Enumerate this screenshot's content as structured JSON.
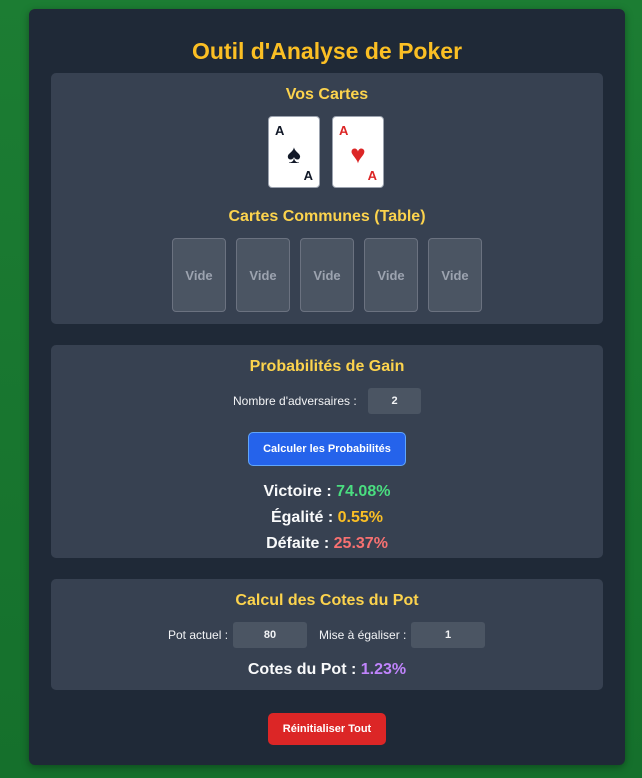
{
  "app": {
    "title": "Outil d'Analyse de Poker"
  },
  "hand": {
    "title": "Vos Cartes",
    "cards": [
      {
        "rank": "A",
        "suit": "♠",
        "color": "black"
      },
      {
        "rank": "A",
        "suit": "♥",
        "color": "red"
      }
    ]
  },
  "board": {
    "title": "Cartes Communes (Table)",
    "slots": [
      "Vide",
      "Vide",
      "Vide",
      "Vide",
      "Vide"
    ]
  },
  "probabilities": {
    "title": "Probabilités de Gain",
    "opponents_label": "Nombre d'adversaires :",
    "opponents_value": "2",
    "calculate_label": "Calculer les Probabilités",
    "win_label": "Victoire :",
    "win_value": "74.08%",
    "tie_label": "Égalité :",
    "tie_value": "0.55%",
    "loss_label": "Défaite :",
    "loss_value": "25.37%"
  },
  "pot": {
    "title": "Calcul des Cotes du Pot",
    "pot_label": "Pot actuel :",
    "pot_value": "80",
    "call_label": "Mise à égaliser :",
    "call_value": "1",
    "odds_label": "Cotes du Pot :",
    "odds_value": "1.23%"
  },
  "reset_label": "Réinitialiser Tout",
  "colors": {
    "accent_gold": "#fbbf24",
    "win": "#4ade80",
    "tie": "#fbbf24",
    "loss": "#f87171",
    "odds": "#c084fc",
    "primary_button": "#2563eb",
    "danger_button": "#dc2626"
  }
}
